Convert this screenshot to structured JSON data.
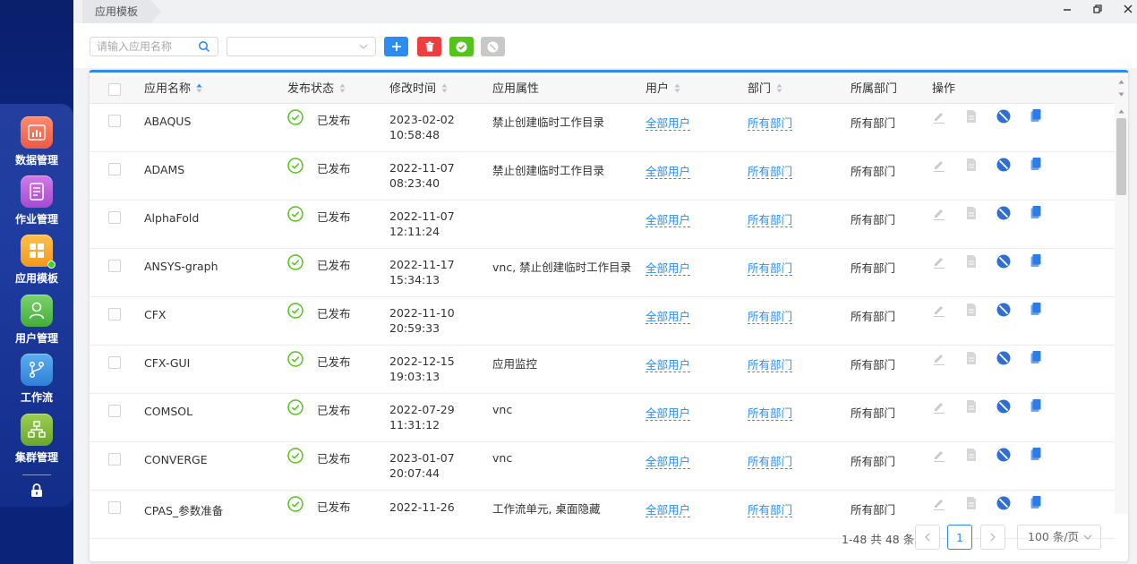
{
  "sidebar": {
    "items": [
      {
        "label": "数据管理",
        "icon": "bar-chart-icon",
        "color": "#f26d55"
      },
      {
        "label": "作业管理",
        "icon": "document-list-icon",
        "color": "#b65bd6"
      },
      {
        "label": "应用模板",
        "icon": "grid-apps-icon",
        "color": "#f3a32a"
      },
      {
        "label": "用户管理",
        "icon": "user-icon",
        "color": "#52b94a"
      },
      {
        "label": "工作流",
        "icon": "branch-icon",
        "color": "#3a8fe0"
      },
      {
        "label": "集群管理",
        "icon": "cluster-icon",
        "color": "#7ab53a"
      }
    ]
  },
  "tabbar": {
    "active_tab": "应用模板"
  },
  "toolbar": {
    "search_placeholder": "请输入应用名称",
    "select_value": "",
    "colors": {
      "add": "#2d8cf0",
      "delete": "#ed3f3f",
      "publish": "#52c41a",
      "disable": "#c8c8c8"
    }
  },
  "table": {
    "headers": {
      "name": "应用名称",
      "status": "发布状态",
      "modified": "修改时间",
      "attr": "应用属性",
      "users": "用户",
      "dept": "部门",
      "owner_dept": "所属部门",
      "actions": "操作"
    },
    "rows": [
      {
        "name": "ABAQUS",
        "status": "已发布",
        "date": "2023-02-02",
        "time": "10:58:48",
        "attr": "禁止创建临时工作目录",
        "users": "全部用户",
        "dept": "所有部门",
        "owner": "所有部门"
      },
      {
        "name": "ADAMS",
        "status": "已发布",
        "date": "2022-11-07",
        "time": "08:23:40",
        "attr": "禁止创建临时工作目录",
        "users": "全部用户",
        "dept": "所有部门",
        "owner": "所有部门"
      },
      {
        "name": "AlphaFold",
        "status": "已发布",
        "date": "2022-11-07",
        "time": "12:11:24",
        "attr": "",
        "users": "全部用户",
        "dept": "所有部门",
        "owner": "所有部门"
      },
      {
        "name": "ANSYS-graph",
        "status": "已发布",
        "date": "2022-11-17",
        "time": "15:34:13",
        "attr": "vnc, 禁止创建临时工作目录",
        "users": "全部用户",
        "dept": "所有部门",
        "owner": "所有部门"
      },
      {
        "name": "CFX",
        "status": "已发布",
        "date": "2022-11-10",
        "time": "20:59:33",
        "attr": "",
        "users": "全部用户",
        "dept": "所有部门",
        "owner": "所有部门"
      },
      {
        "name": "CFX-GUI",
        "status": "已发布",
        "date": "2022-12-15",
        "time": "19:03:13",
        "attr": "应用监控",
        "users": "全部用户",
        "dept": "所有部门",
        "owner": "所有部门"
      },
      {
        "name": "COMSOL",
        "status": "已发布",
        "date": "2022-07-29",
        "time": "11:31:12",
        "attr": "vnc",
        "users": "全部用户",
        "dept": "所有部门",
        "owner": "所有部门"
      },
      {
        "name": "CONVERGE",
        "status": "已发布",
        "date": "2023-01-07",
        "time": "20:07:44",
        "attr": "vnc",
        "users": "全部用户",
        "dept": "所有部门",
        "owner": "所有部门"
      },
      {
        "name": "CPAS_参数准备",
        "status": "已发布",
        "date": "2022-11-26",
        "time": "",
        "attr": "工作流单元, 桌面隐藏",
        "users": "全部用户",
        "dept": "所有部门",
        "owner": "所有部门"
      }
    ]
  },
  "pagination": {
    "info": "1-48 共 48 条",
    "current_page": "1",
    "page_size": "100 条/页"
  }
}
